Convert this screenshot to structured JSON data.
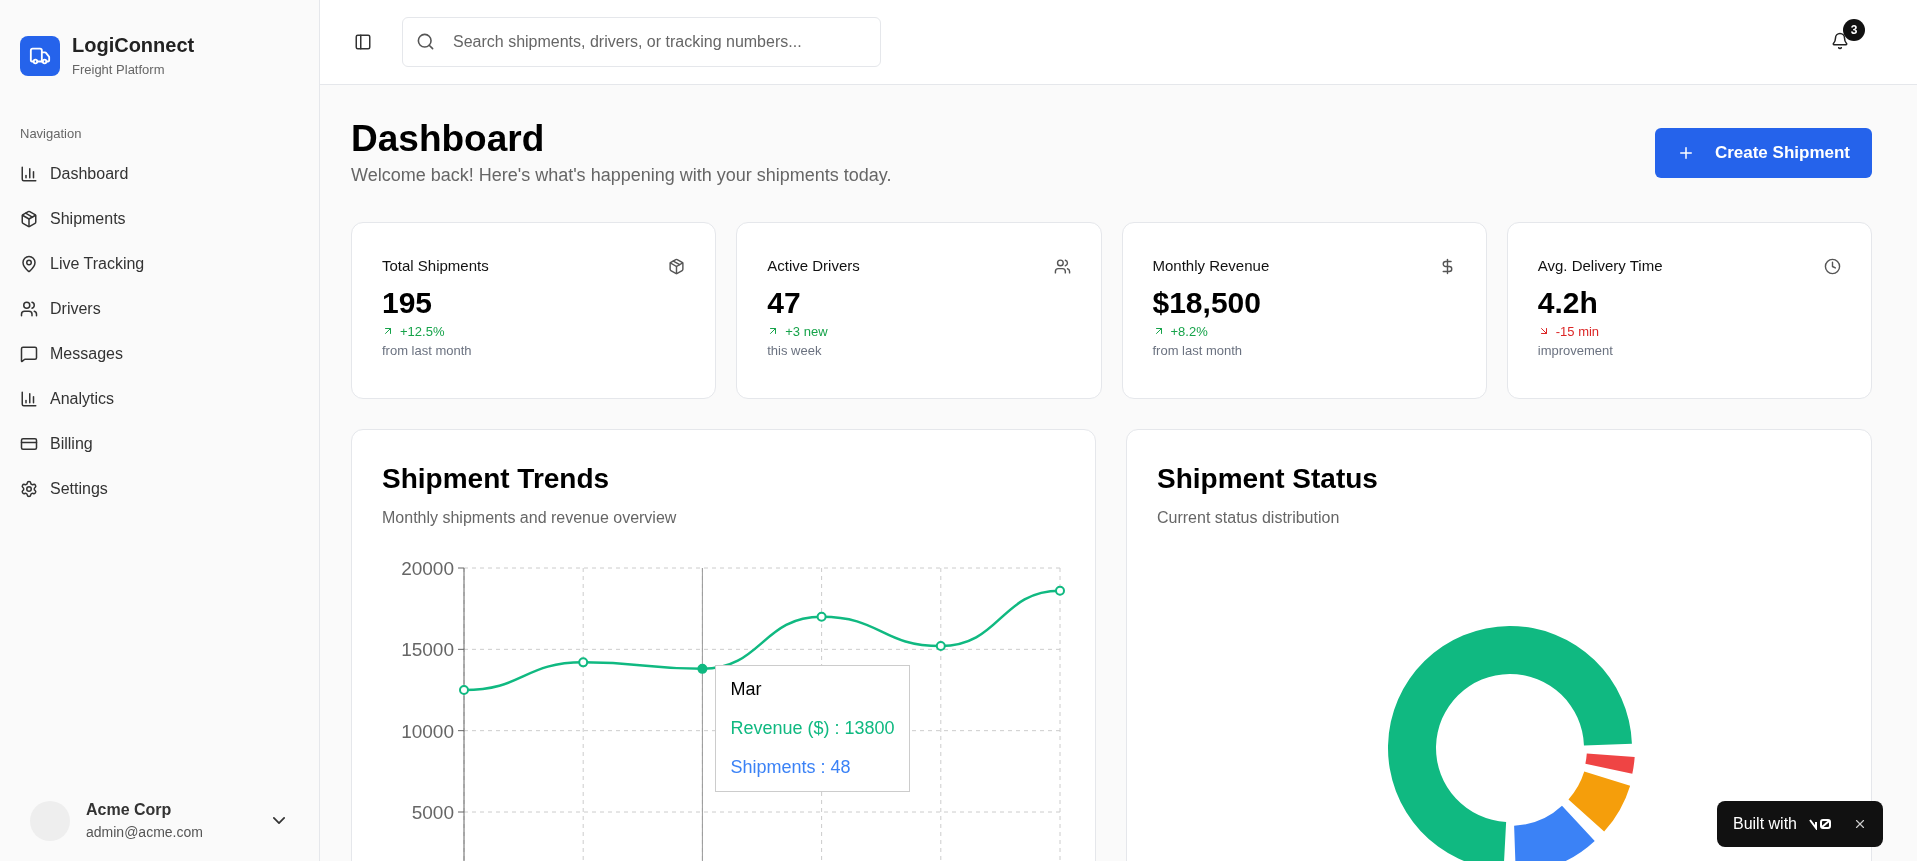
{
  "brand": {
    "name": "LogiConnect",
    "subtitle": "Freight Platform"
  },
  "sidebar": {
    "section": "Navigation",
    "items": [
      {
        "label": "Dashboard"
      },
      {
        "label": "Shipments"
      },
      {
        "label": "Live Tracking"
      },
      {
        "label": "Drivers"
      },
      {
        "label": "Messages"
      },
      {
        "label": "Analytics"
      },
      {
        "label": "Billing"
      },
      {
        "label": "Settings"
      }
    ],
    "account": {
      "name": "Acme Corp",
      "email": "admin@acme.com"
    }
  },
  "header": {
    "search": {
      "placeholder": "Search shipments, drivers, or tracking numbers..."
    },
    "notifications": "3"
  },
  "page": {
    "title": "Dashboard",
    "subtitle": "Welcome back! Here's what's happening with your shipments today.",
    "action": "Create Shipment"
  },
  "stats": [
    {
      "title": "Total Shipments",
      "value": "195",
      "change": "+12.5%",
      "positive": true,
      "note": "from last month"
    },
    {
      "title": "Active Drivers",
      "value": "47",
      "change": "+3 new",
      "positive": true,
      "note": "this week"
    },
    {
      "title": "Monthly Revenue",
      "value": "$18,500",
      "change": "+8.2%",
      "positive": true,
      "note": "from last month"
    },
    {
      "title": "Avg. Delivery Time",
      "value": "4.2h",
      "change": "-15 min",
      "positive": false,
      "note": "improvement"
    }
  ],
  "trends": {
    "title": "Shipment Trends",
    "subtitle": "Monthly shipments and revenue overview",
    "chart_data": {
      "type": "line",
      "series": [
        {
          "name": "Revenue ($)",
          "color": "#10b981",
          "marker": "circle",
          "values": [
            12500,
            14200,
            13800,
            17000,
            15200,
            18600
          ]
        }
      ],
      "ylim": [
        0,
        20000
      ],
      "yticks": [
        5000,
        10000,
        15000,
        20000
      ],
      "grid": true
    },
    "tooltip": {
      "label": "Mar",
      "separator": ":",
      "rows": [
        {
          "value": "13800"
        },
        {
          "name": "Shipments",
          "value": "48",
          "color": "#3b82f6"
        }
      ]
    }
  },
  "status": {
    "title": "Shipment Status",
    "subtitle": "Current status distribution"
  },
  "badge": {
    "text": "Built with"
  }
}
